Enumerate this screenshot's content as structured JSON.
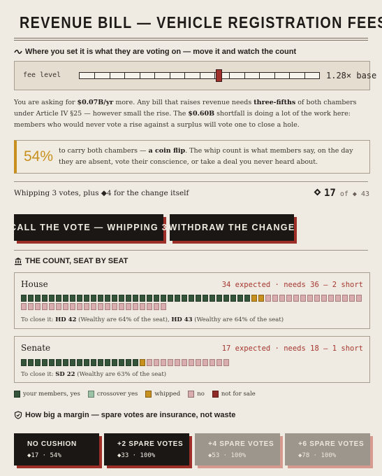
{
  "header": {
    "title": "REVENUE BILL — VEHICLE REGISTRATION FEES"
  },
  "slider": {
    "heading": "Where you set it is what they are voting on — move it and watch the count",
    "label": "fee level",
    "value_text": "1.28× base",
    "ticks": 16,
    "thumb_fraction": 0.58
  },
  "explanation": {
    "p1": "You are asking for ",
    "amount": "$0.07B/yr",
    "p2": " more. Any bill that raises revenue needs ",
    "threshold": "three-fifths",
    "p3": " of both chambers under Article IV §25 — however small the rise. The ",
    "shortfall": "$0.60B",
    "p4": " shortfall is doing a lot of the work here: members who would never vote a rise against a surplus will vote one to close a hole."
  },
  "flip": {
    "pct": "54%",
    "t1": "to carry both chambers — ",
    "bold": "a coin flip",
    "t2": ". The whip count is what members say, on the day they are absent, vote their conscience, or take a deal you never heard about."
  },
  "whip": {
    "text": "Whipping 3 votes, plus ◆4 for the change itself",
    "count": "17",
    "of": "of ◆ 43"
  },
  "buttons": {
    "call": "CALL THE VOTE — WHIPPING 3",
    "withdraw": "WITHDRAW THE CHANGE"
  },
  "count_heading": "THE COUNT, SEAT BY SEAT",
  "house": {
    "name": "House",
    "status": "34 expected · needs 36 — 2 short",
    "seats": {
      "m": 33,
      "c": 0,
      "w": 2,
      "n": 35,
      "s": 0
    },
    "close_prefix": "To close it: ",
    "d1": "HD 42",
    "n1": " (Wealthy are 64% of the seat), ",
    "d2": "HD 43",
    "n2": " (Wealthy are 64% of the seat)"
  },
  "senate": {
    "name": "Senate",
    "status": "17 expected · needs 18 — 1 short",
    "seats": {
      "m": 17,
      "c": 0,
      "w": 1,
      "n": 12,
      "s": 0
    },
    "close_prefix": "To close it: ",
    "d1": "SD 22",
    "n1": " (Wealthy are 63% of the seat)"
  },
  "legend": [
    {
      "label": "your members, yes",
      "color": "#34553a"
    },
    {
      "label": "crossover yes",
      "color": "#9bc2a5"
    },
    {
      "label": "whipped",
      "color": "#c8911f"
    },
    {
      "label": "no",
      "color": "#d9adad"
    },
    {
      "label": "not for sale",
      "color": "#8f2a26"
    }
  ],
  "margin": {
    "heading": "How big a margin — spare votes are insurance, not waste",
    "options": [
      {
        "label": "NO CUSHION",
        "sub": "◆17 · 54%"
      },
      {
        "label": "+2 SPARE VOTES",
        "sub": "◆33 · 100%"
      },
      {
        "label": "+4 SPARE VOTES",
        "sub": "◆53 · 100%"
      },
      {
        "label": "+6 SPARE VOTES",
        "sub": "◆78 · 100%"
      }
    ]
  }
}
